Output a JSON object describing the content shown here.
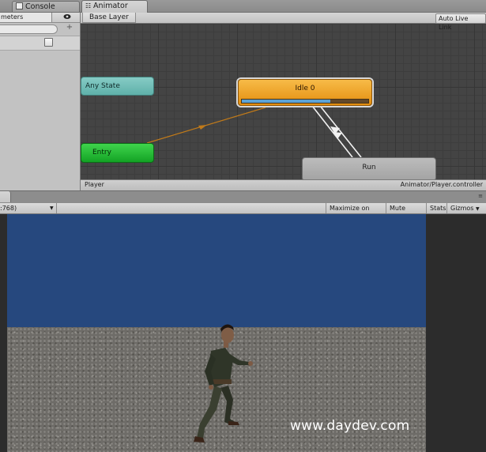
{
  "tabs": {
    "console": "Console",
    "animator": "Animator"
  },
  "animator": {
    "parameters_tab": "meters",
    "layer": "Base Layer",
    "auto_live_link": "Auto Live Link",
    "states": {
      "any_state": "Any State",
      "entry": "Entry",
      "idle": "Idle 0",
      "run": "Run"
    },
    "idle_progress": 0.7,
    "status_object": "Player",
    "status_controller": "Animator/Player.controller"
  },
  "game": {
    "aspect": ":768)",
    "maximize_on_play": "Maximize on Play",
    "mute_audio": "Mute audio",
    "stats": "Stats",
    "gizmos": "Gizmos"
  },
  "watermark": "www.daydev.com",
  "colors": {
    "any_state": "#6cbdb6",
    "entry": "#1fb331",
    "idle": "#ee9f24",
    "run": "#b0b0b0",
    "sky": "#26487e",
    "transition_arrow": "#c07a1a"
  }
}
